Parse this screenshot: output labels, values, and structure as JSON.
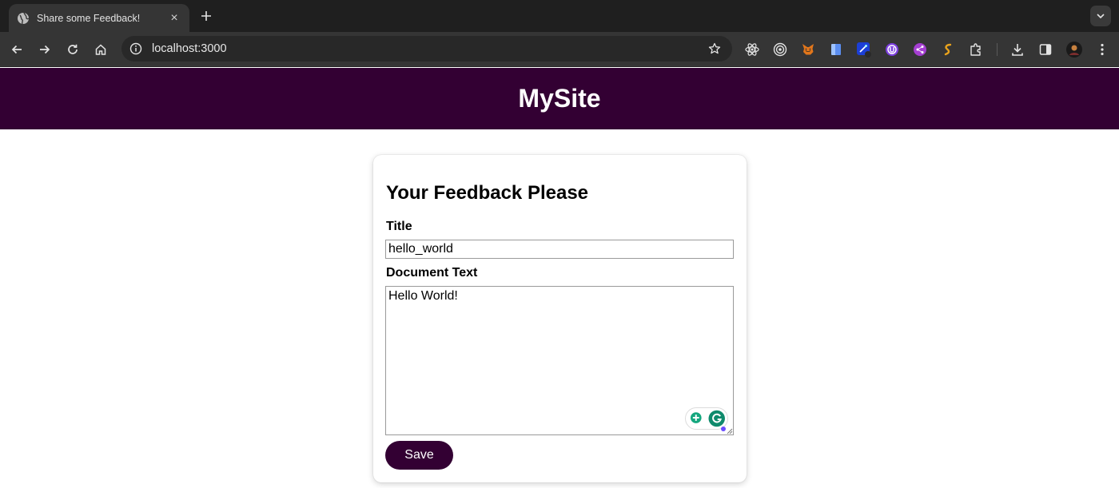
{
  "browser": {
    "tab_title": "Share some Feedback!",
    "tab_close": "×",
    "new_tab": "+",
    "url": "localhost:3000"
  },
  "site": {
    "header_title": "MySite",
    "header_color": "#330033"
  },
  "form": {
    "heading": "Your Feedback Please",
    "title_label": "Title",
    "title_value": "hello_world",
    "text_label": "Document Text",
    "text_value": "Hello World!",
    "save_label": "Save",
    "accent_color": "#330033"
  },
  "icons": {
    "tab": "globe-icon",
    "back": "back-arrow-icon",
    "forward": "forward-arrow-icon",
    "reload": "reload-icon",
    "home": "home-icon",
    "site_info": "info-icon",
    "bookmark": "star-icon",
    "extensions": [
      "react-devtools-icon",
      "target-icon",
      "metamask-fox-icon",
      "book-icon",
      "wand-icon",
      "purple-circle-icon",
      "share-icon",
      "swirl-icon",
      "puzzle-icon"
    ],
    "download": "download-icon",
    "side_panel": "side-panel-icon",
    "profile": "avatar-icon",
    "menu": "kebab-menu-icon",
    "grammarly": "grammarly-icon"
  }
}
